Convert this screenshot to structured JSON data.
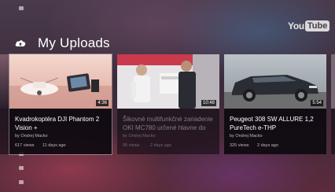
{
  "section": {
    "title": "My Uploads",
    "icon": "upload-cloud-icon"
  },
  "logo": {
    "you": "You",
    "tube": "Tube"
  },
  "rail": {
    "icons": [
      "home-icon",
      "menu-icon",
      "menu-icon",
      "menu-icon"
    ]
  },
  "videos": [
    {
      "title": "Kvadrokoptéra DJI Phantom 2 Vision +",
      "duration": "4:36",
      "channel": "by Ondrej Macko",
      "views": "617 views",
      "age": "11 days ago",
      "selected": true
    },
    {
      "title": "Šikovné multifunkčné zariadenie OKI MC780 určené hlavne do",
      "duration": "10:48",
      "channel": "by Ondrej Macko",
      "views": "95 views",
      "age": "2 days ago",
      "selected": false
    },
    {
      "title": "Peugeot 308 SW ALLURE 1,2 PureTech e-THP",
      "duration": "5:54",
      "channel": "by Ondrej Macko",
      "views": "325 views",
      "age": "2 days ago",
      "selected": false
    }
  ],
  "colors": {
    "background": "#3b2b3a",
    "card": "#0a080e",
    "text": "#ffffff",
    "meta": "#bdbdbd"
  }
}
